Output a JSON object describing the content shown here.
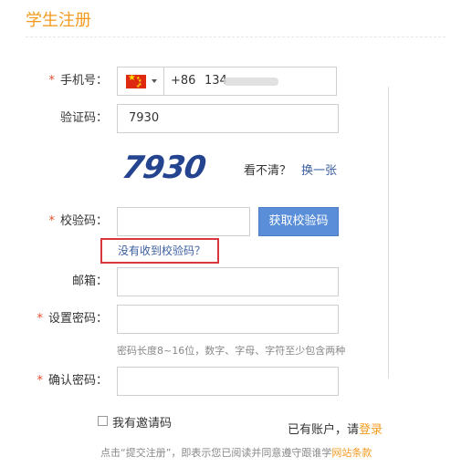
{
  "page": {
    "title": "学生注册"
  },
  "form": {
    "phone": {
      "required_mark": "*",
      "label": "手机号：",
      "country_code": "+86",
      "value_visible": "134"
    },
    "captcha": {
      "label": "验证码：",
      "value": "7930",
      "image_text": "7930",
      "hint": "看不清？",
      "refresh_link": "换一张"
    },
    "verify_code": {
      "required_mark": "*",
      "label": "校验码：",
      "value": "",
      "button_label": "获取校验码",
      "no_code_link": "没有收到校验码？"
    },
    "email": {
      "label": "邮箱：",
      "value": ""
    },
    "password": {
      "required_mark": "*",
      "label": "设置密码：",
      "value": "",
      "hint": "密码长度8~16位，数字、字母、字符至少包含两种"
    },
    "confirm_password": {
      "required_mark": "*",
      "label": "确认密码：",
      "value": ""
    },
    "invite": {
      "label": "我有邀请码",
      "checked": false
    },
    "account": {
      "prompt": "已有账户，请",
      "login_link": "登录"
    },
    "terms": {
      "prefix": "点击“提交注册”，即表示您已阅读并同意遵守跟谁学",
      "link": "网站条款"
    }
  },
  "colors": {
    "accent_orange": "#f39a1f",
    "button_blue": "#5a8ed8",
    "link_blue": "#3b5fa0",
    "captcha_blue": "#25448f",
    "highlight_red": "#d9373b",
    "required_red": "#e0502f"
  },
  "icons": {
    "country_flag": "china-flag-icon",
    "dropdown": "caret-down-icon"
  }
}
